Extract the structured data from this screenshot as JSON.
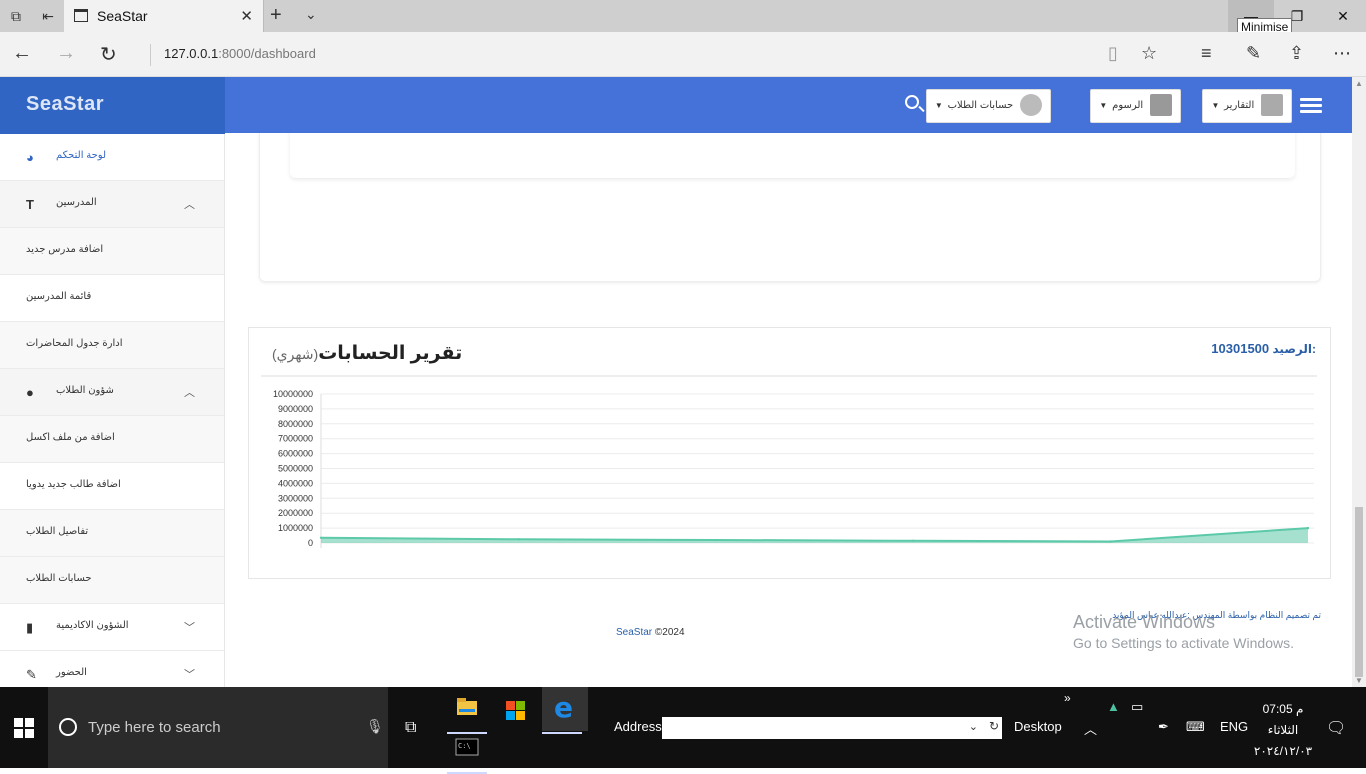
{
  "browser": {
    "tab_title": "SeaStar",
    "url_host": "127.0.0.1",
    "url_rest": ":8000/dashboard",
    "tooltip": "Minimise"
  },
  "app": {
    "brand": "SeaStar",
    "header": {
      "reports_label": "التقارير",
      "fees_label": "الرسوم",
      "accounts_label": "حسابات الطلاب"
    }
  },
  "sidebar": {
    "items": [
      {
        "label": "لوحة التحكم",
        "icon": "dashboard-icon",
        "active": true
      },
      {
        "label": "المدرسين",
        "icon": "text-icon",
        "chevron": "up"
      },
      {
        "label": "اضافة مدرس جديد"
      },
      {
        "label": "قائمة المدرسين"
      },
      {
        "label": "ادارة جدول المحاضرات"
      },
      {
        "label": "شؤون الطلاب",
        "icon": "user-icon",
        "chevron": "up"
      },
      {
        "label": "اضافة من ملف اكسل"
      },
      {
        "label": "اضافة طالب جديد يدويا"
      },
      {
        "label": "تفاصيل الطلاب"
      },
      {
        "label": "حسابات الطلاب"
      },
      {
        "label": "الشؤون الاكاديمية",
        "icon": "book-icon",
        "chevron": "down"
      },
      {
        "label": "الحضور",
        "icon": "pencil-icon",
        "chevron": "down"
      }
    ]
  },
  "report": {
    "title": "تقرير الحسابات",
    "subtitle": "(شهري)",
    "balance_label": "الرصيد:",
    "balance_value": "10301500"
  },
  "chart_data": {
    "type": "area",
    "y_ticks": [
      "10000000",
      "9000000",
      "8000000",
      "7000000",
      "6000000",
      "5000000",
      "4000000",
      "3000000",
      "2000000",
      "1000000",
      "0"
    ],
    "ylim": [
      0,
      10000000
    ],
    "series": [
      {
        "values": [
          350000,
          250000,
          200000,
          150000,
          100000,
          1000000
        ],
        "color": "#5cc9a8"
      }
    ],
    "grid": true
  },
  "footer": {
    "credit": "تم تصميم النظام بواسطة المهندس :عبدالله عباس المؤيد",
    "copyright_brand": "SeaStar",
    "copyright_text": "©2024"
  },
  "watermark": {
    "line1": "Activate Windows",
    "line2": "Go to Settings to activate Windows."
  },
  "taskbar": {
    "search_placeholder": "Type here to search",
    "address_label": "Address",
    "desktop_label": "Desktop",
    "lang": "ENG",
    "time": "07:05 م",
    "day": "الثلاثاء",
    "date": "٢٠٢٤/١٢/٠٣"
  }
}
